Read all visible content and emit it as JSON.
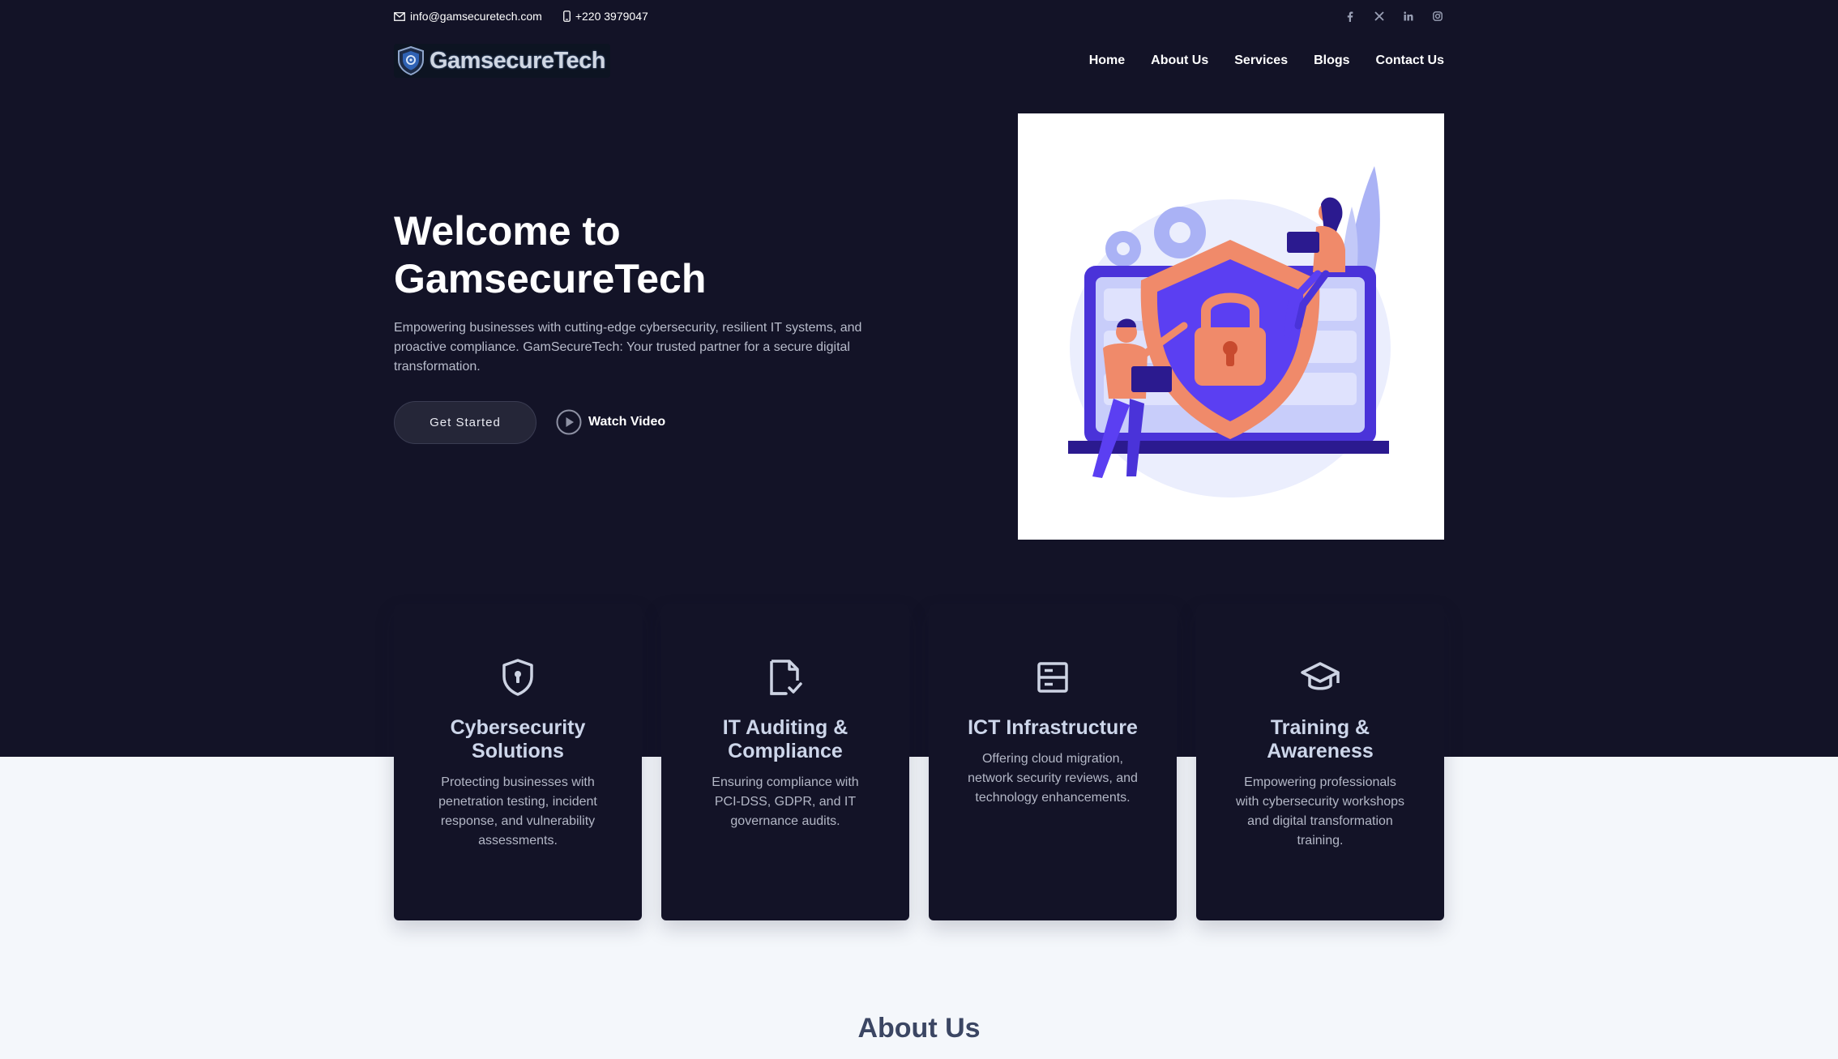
{
  "topbar": {
    "email": "info@gamsecuretech.com",
    "phone": "+220 3979047",
    "socials": [
      "facebook-icon",
      "x-icon",
      "linkedin-icon",
      "instagram-icon"
    ]
  },
  "brand": {
    "name": "GamsecureTech"
  },
  "nav": {
    "items": [
      "Home",
      "About Us",
      "Services",
      "Blogs",
      "Contact Us"
    ]
  },
  "hero": {
    "title_line1": "Welcome to",
    "title_line2": "GamsecureTech",
    "subtitle": "Empowering businesses with cutting-edge cybersecurity, resilient IT systems, and proactive compliance. GamSecureTech: Your trusted partner for a secure digital transformation.",
    "cta_label": "Get Started",
    "video_label": "Watch Video"
  },
  "services": [
    {
      "icon": "shield-lock-icon",
      "title": "Cybersecurity Solutions",
      "desc": "Protecting businesses with penetration testing, incident response, and vulnerability assessments."
    },
    {
      "icon": "file-check-icon",
      "title": "IT Auditing & Compliance",
      "desc": "Ensuring compliance with PCI-DSS, GDPR, and IT governance audits."
    },
    {
      "icon": "server-icon",
      "title": "ICT Infrastructure",
      "desc": "Offering cloud migration, network security reviews, and technology enhancements."
    },
    {
      "icon": "graduation-cap-icon",
      "title": "Training & Awareness",
      "desc": "Empowering professionals with cybersecurity workshops and digital transformation training."
    }
  ],
  "about": {
    "heading": "About Us"
  },
  "colors": {
    "dark_bg": "#131327",
    "light_bg": "#f4f7fb",
    "accent_orange": "#f08a6a",
    "accent_purple": "#5b3ff2"
  }
}
